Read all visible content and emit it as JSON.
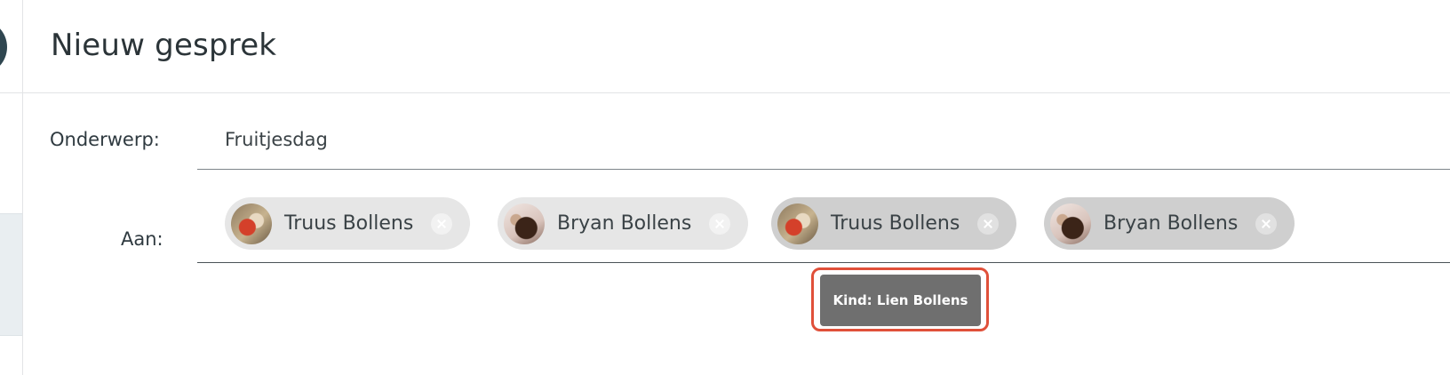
{
  "header": {
    "title": "Nieuw gesprek"
  },
  "form": {
    "subject_label": "Onderwerp:",
    "subject_value": "Fruitjesdag",
    "to_label": "Aan:"
  },
  "recipients": [
    {
      "name": "Truus Bollens",
      "avatar_icon": "person-photo-icon"
    },
    {
      "name": "Bryan Bollens",
      "avatar_icon": "person-photo-icon"
    },
    {
      "name": "Truus Bollens",
      "avatar_icon": "person-photo-icon"
    },
    {
      "name": "Bryan Bollens",
      "avatar_icon": "person-photo-icon"
    }
  ],
  "tooltip": {
    "text": "Kind: Lien Bollens"
  },
  "colors": {
    "chip_light": "#e6e6e6",
    "chip_dark": "#cfcfcf",
    "tooltip_bg": "#6f6f6f",
    "highlight": "#e0503a",
    "rail_circle": "#2f4650"
  }
}
